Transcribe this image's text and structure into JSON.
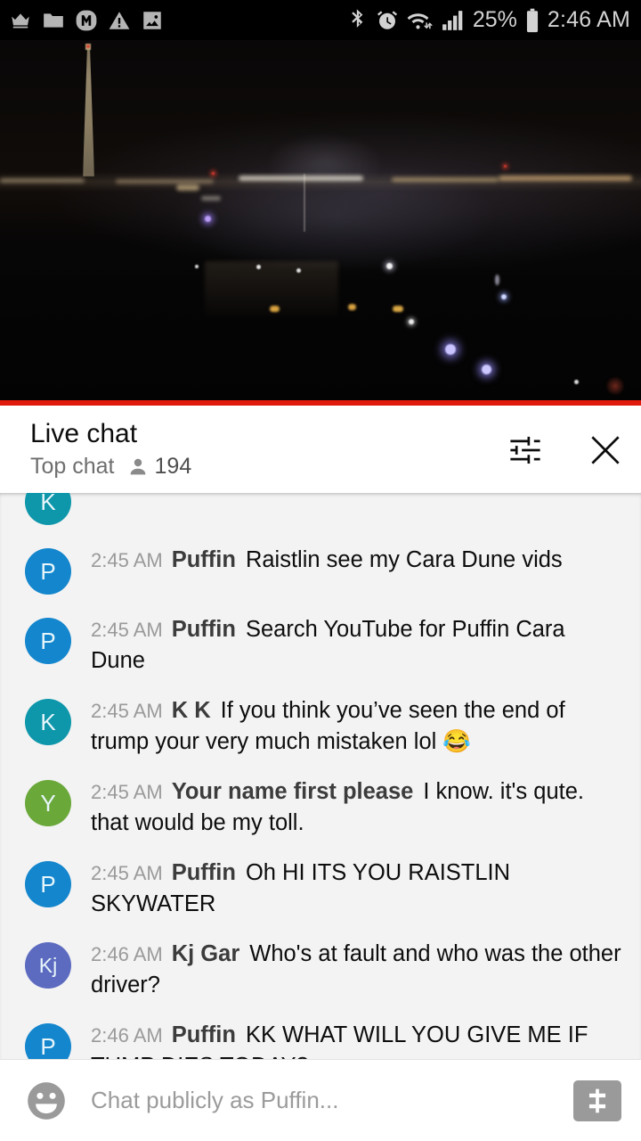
{
  "status_bar": {
    "left_icons": [
      "crown-icon",
      "folder-icon",
      "m-badge-icon",
      "warning-icon",
      "image-icon"
    ],
    "right_icons": [
      "bluetooth-icon",
      "alarm-icon",
      "wifi-icon",
      "signal-icon"
    ],
    "battery_percent": "25%",
    "time": "2:46 AM"
  },
  "video": {
    "name": "live-stream-washington-dc-night",
    "progress_color": "#e01b0e"
  },
  "chat_header": {
    "title": "Live chat",
    "mode": "Top chat",
    "viewer_count": "194",
    "settings_icon": "tune-icon",
    "close_icon": "close-icon"
  },
  "messages": [
    {
      "avatar_letter": "K",
      "avatar_color": "#0e96aa",
      "timestamp": "",
      "author": "",
      "text": "",
      "partial": true
    },
    {
      "avatar_letter": "P",
      "avatar_color": "#1386cd",
      "timestamp": "2:45 AM",
      "author": "Puffin",
      "text": "Raistlin see my Cara Dune vids"
    },
    {
      "avatar_letter": "P",
      "avatar_color": "#1386cd",
      "timestamp": "2:45 AM",
      "author": "Puffin",
      "text": "Search YouTube for Puffin Cara Dune"
    },
    {
      "avatar_letter": "K",
      "avatar_color": "#0e96aa",
      "timestamp": "2:45 AM",
      "author": "K K",
      "text": "If you think you’ve seen the end of trump your very much mistaken lol 😂"
    },
    {
      "avatar_letter": "Y",
      "avatar_color": "#6aa83a",
      "timestamp": "2:45 AM",
      "author": "Your name first please",
      "text": "I know. it's qute. that would be my toll."
    },
    {
      "avatar_letter": "P",
      "avatar_color": "#1386cd",
      "timestamp": "2:45 AM",
      "author": "Puffin",
      "text": "Oh HI ITS YOU RAISTLIN SKYWATER"
    },
    {
      "avatar_letter": "Kj",
      "avatar_color": "#5c6bc0",
      "timestamp": "2:46 AM",
      "author": "Kj Gar",
      "text": "Who's at fault and who was the other driver?"
    },
    {
      "avatar_letter": "P",
      "avatar_color": "#1386cd",
      "timestamp": "2:46 AM",
      "author": "Puffin",
      "text": "KK WHAT WILL YOU GIVE ME IF TUMP DIES TODAY?"
    }
  ],
  "composer": {
    "emoji_icon": "emoji-face-icon",
    "placeholder": "Chat publicly as Puffin...",
    "value": "",
    "superchat_icon": "dollar-icon"
  }
}
